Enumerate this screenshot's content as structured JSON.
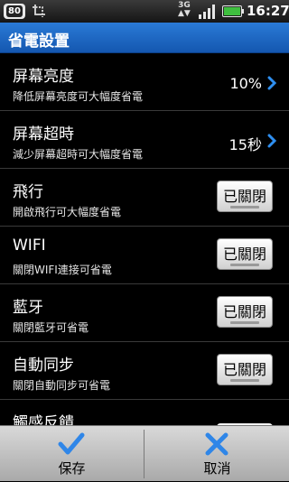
{
  "status_bar": {
    "badge": "80",
    "network": "3G",
    "time": "16:27"
  },
  "title": "省電設置",
  "settings": [
    {
      "label": "屏幕亮度",
      "sub": "降低屏幕亮度可大幅度省電",
      "value": "10%"
    },
    {
      "label": "屏幕超時",
      "sub": "減少屏幕超時可大幅度省電",
      "value": "15秒"
    },
    {
      "label": "飛行",
      "sub": "開啟飛行可大幅度省電",
      "toggle": "已關閉"
    },
    {
      "label": "WIFI",
      "sub": "關閉WIFI連接可省電",
      "toggle": "已關閉"
    },
    {
      "label": "藍牙",
      "sub": "關閉藍牙可省電",
      "toggle": "已關閉"
    },
    {
      "label": "自動同步",
      "sub": "關閉自動同步可省電",
      "toggle": "已關閉"
    },
    {
      "label": "觸感反饋"
    }
  ],
  "actions": {
    "save": "保存",
    "cancel": "取消"
  },
  "colors": {
    "title_bar": "#1e6ac4",
    "chevron": "#2f8ff0",
    "check": "#2f86e8"
  }
}
